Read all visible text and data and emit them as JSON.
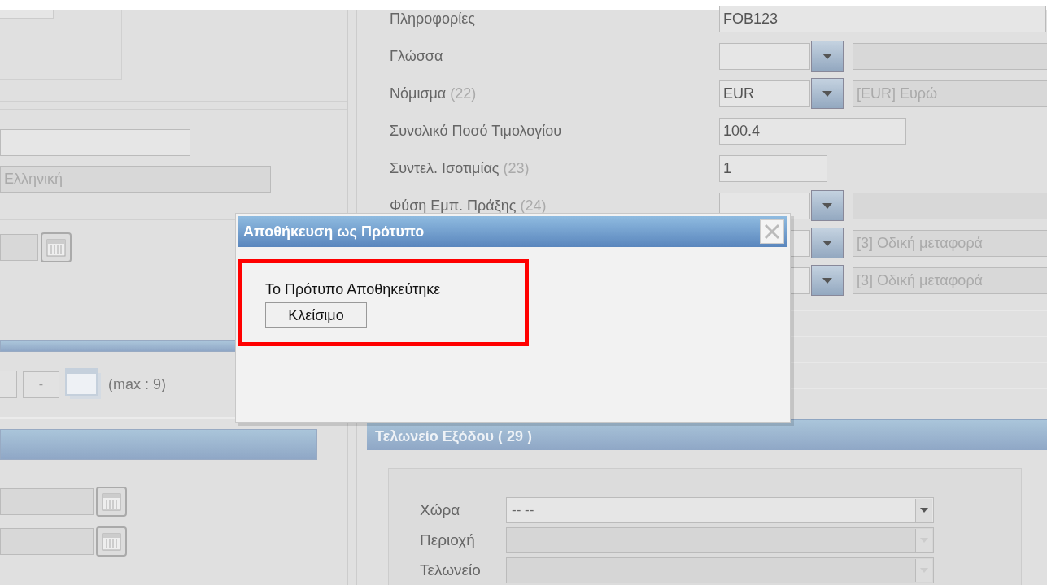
{
  "left_panel": {
    "language_field": {
      "value": "Ελληνική",
      "disabled": true
    },
    "attachments": {
      "remove_button": "-",
      "limit": "(max : 9)"
    }
  },
  "form": {
    "rows": [
      {
        "kind": "text",
        "label": "Πληροφορίες",
        "value": "FOB123"
      },
      {
        "kind": "select",
        "label": "Γλώσσα"
      },
      {
        "kind": "select",
        "label": "Νόμισμα",
        "ref": "(22)",
        "value": "EUR",
        "description": "[EUR] Ευρώ"
      },
      {
        "kind": "text",
        "label": "Συνολικό Ποσό Τιμολογίου",
        "value": "100.4"
      },
      {
        "kind": "text",
        "label": "Συντελ. Ισοτιμίας",
        "ref": "(23)",
        "value": "1"
      },
      {
        "kind": "select",
        "label": "Φύση Εμπ. Πράξης",
        "ref": "(24)"
      },
      {
        "kind": "select",
        "description": "[3] Οδική μεταφορά"
      },
      {
        "kind": "select",
        "description": "[3] Οδική μεταφορά"
      }
    ]
  },
  "exit_customs": {
    "title": "Τελωνείο Εξόδου ( 29 )",
    "fields": [
      {
        "label": "Χώρα",
        "value": "-- --",
        "disabled": false
      },
      {
        "label": "Περιοχή",
        "disabled": true
      },
      {
        "label": "Τελωνείο",
        "disabled": true
      }
    ]
  },
  "dialog": {
    "title": "Αποθήκευση ως Πρότυπο",
    "message": "Το Πρότυπο Αποθηκεύτηκε",
    "button": "Κλείσιμο"
  }
}
